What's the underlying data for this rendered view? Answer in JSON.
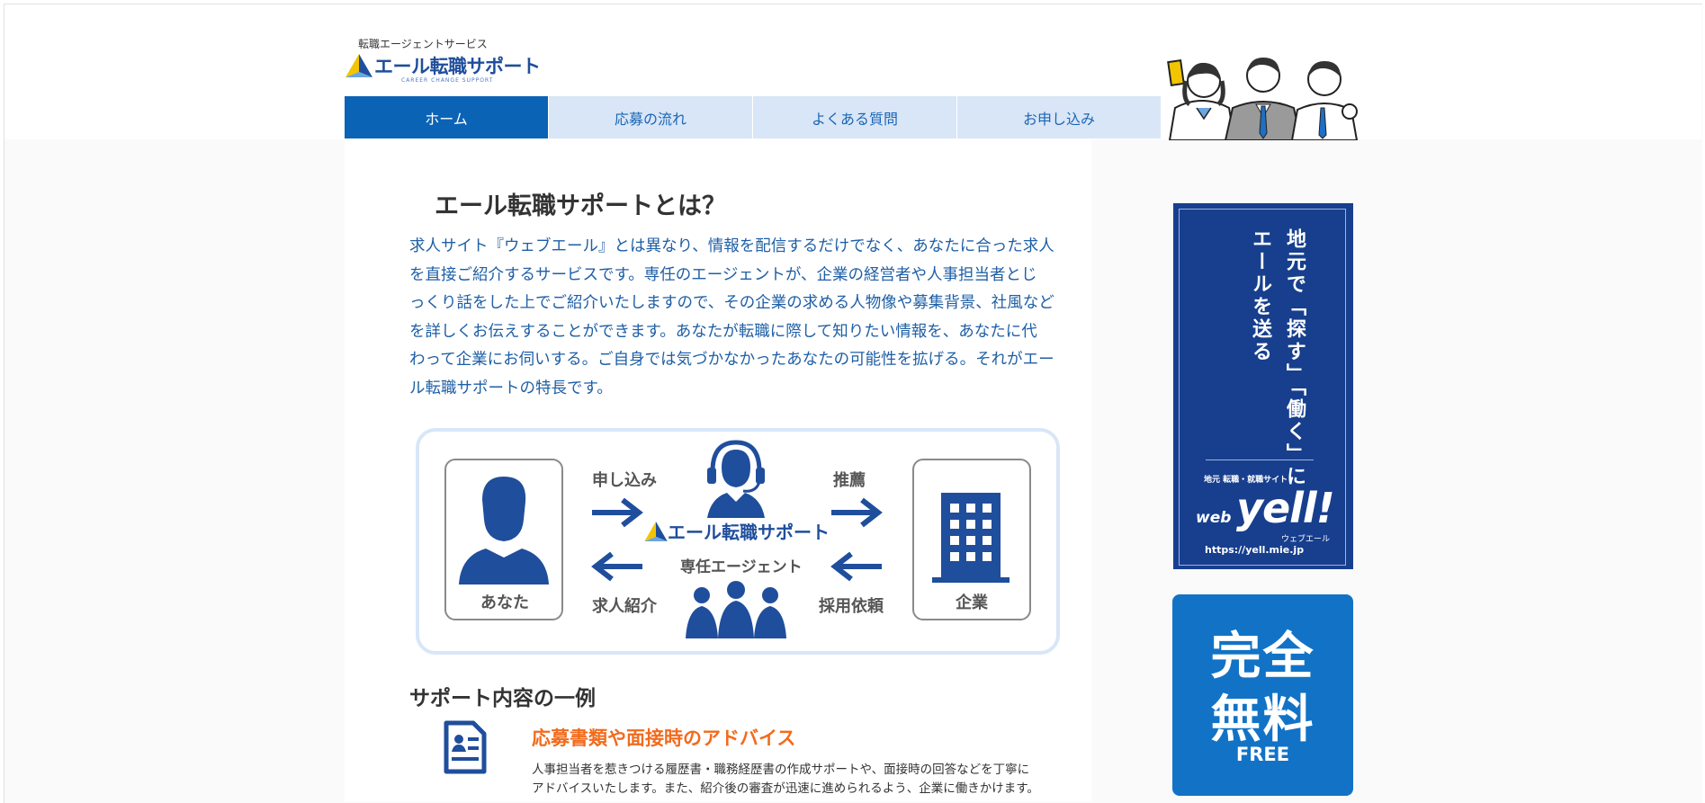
{
  "colors": {
    "primary": "#0b63b6",
    "nav_bg": "#d9e6f7",
    "intro_text": "#1f5fa6",
    "accent_orange": "#f26b1d",
    "banner_navy": "#173f8e",
    "banner_blue": "#1273c6"
  },
  "logo": {
    "subtitle": "転職エージェントサービス",
    "name": "エール転職サポート",
    "tagline": "CAREER CHANGE SUPPORT"
  },
  "nav": {
    "items": [
      {
        "label": "ホーム",
        "active": true
      },
      {
        "label": "応募の流れ",
        "active": false
      },
      {
        "label": "よくある質問",
        "active": false
      },
      {
        "label": "お申し込み",
        "active": false
      }
    ]
  },
  "main": {
    "title": "エール転職サポートとは？",
    "intro_lines": [
      "求人サイト『ウェブエール』とは異なり、情報を配信するだけでなく、あなたに合った求人",
      "を直接ご紹介するサービスです。専任のエージェントが、企業の経営者や人事担当者とじ",
      "っくり話をした上でご紹介いたしますので、その企業の求める人物像や募集背景、社風など",
      "を詳しくお伝えすることができます。あなたが転職に際して知りたい情報を、あなたに代",
      "わって企業にお伺いする。ご自身では気づかなかったあなたの可能性を拡げる。それがエー",
      "ル転職サポートの特長です。"
    ]
  },
  "diagram": {
    "you": "あなた",
    "company": "企業",
    "apply": "申し込み",
    "introduce": "求人紹介",
    "recommend": "推薦",
    "request": "採用依頼",
    "agent": "専任エージェント",
    "brand": "エール転職サポート"
  },
  "support": {
    "heading": "サポート内容の一例",
    "item_title": "応募書類や面接時のアドバイス",
    "item_text_lines": [
      "人事担当者を惹きつける履歴書・職務経歴書の作成サポートや、面接時の回答などを丁寧に",
      "アドバイスいたします。また、紹介後の審査が迅速に進められるよう、企業に働きかけます。"
    ]
  },
  "sidebar": {
    "yell_banner": {
      "line1": "地元で「探す」「働く」に",
      "line2": "エールを送る",
      "small": "地元 転職・就職サイト",
      "web": "web",
      "brand": "yell",
      "kana": "ウェブエール",
      "url": "https://yell.mie.jp"
    },
    "free_banner": {
      "line1": "完全",
      "line2": "無料",
      "line3": "FREE"
    }
  }
}
